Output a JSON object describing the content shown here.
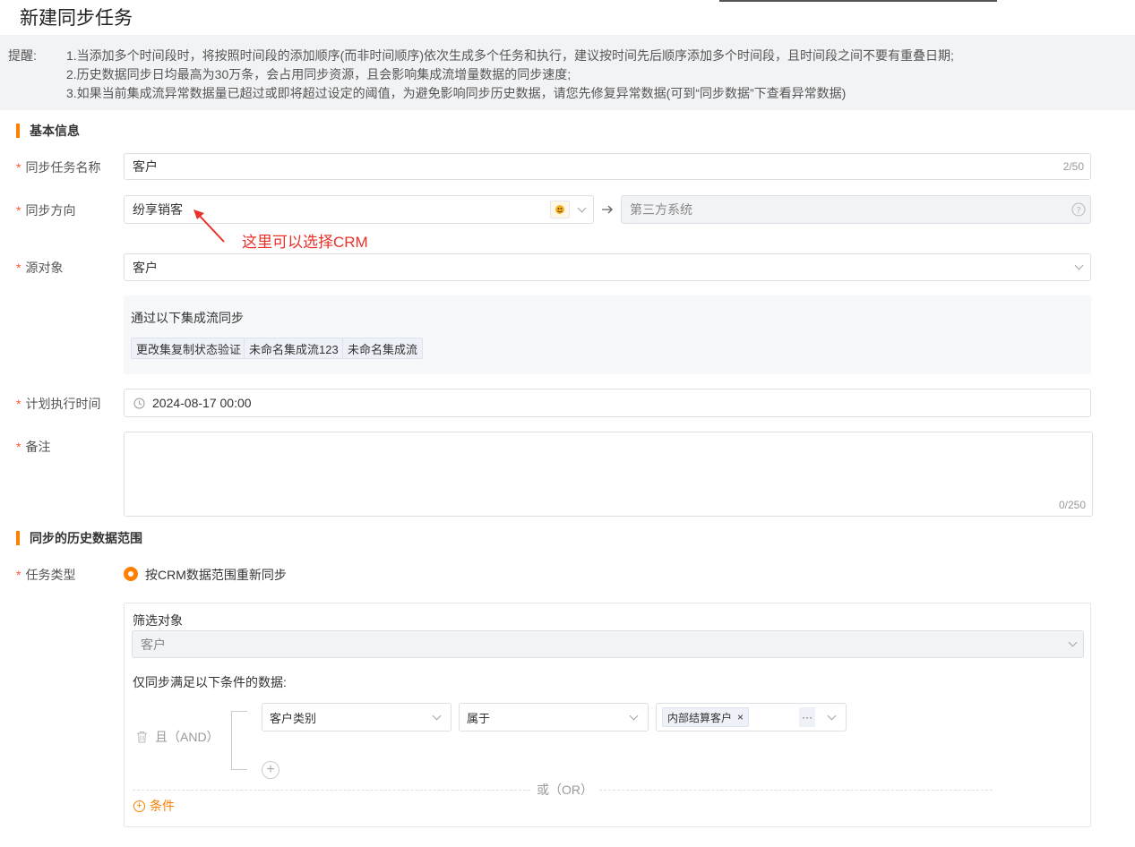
{
  "header": {
    "title": "新建同步任务"
  },
  "notice": {
    "label": "提醒:",
    "lines": [
      "1.当添加多个时间段时，将按照时间段的添加顺序(而非时间顺序)依次生成多个任务和执行，建议按时间先后顺序添加多个时间段，且时间段之间不要有重叠日期;",
      "2.历史数据同步日均最高为30万条，会占用同步资源，且会影响集成流增量数据的同步速度;",
      "3.如果当前集成流异常数据量已超过或即将超过设定的阈值，为避免影响同步历史数据，请您先修复异常数据(可到“同步数据”下查看异常数据)"
    ]
  },
  "basic": {
    "section_title": "基本信息",
    "required_mark": "*",
    "task_name_label": "同步任务名称",
    "task_name_value": "客户",
    "task_name_count": "2/50",
    "direction_label": "同步方向",
    "direction_source": "纷享销客",
    "direction_target": "第三方系统",
    "annotation": "这里可以选择CRM",
    "source_object_label": "源对象",
    "source_object_value": "客户",
    "flow_title": "通过以下集成流同步",
    "flows": [
      "更改集复制状态验证",
      "未命名集成流123",
      "未命名集成流"
    ],
    "schedule_label": "计划执行时间",
    "schedule_value": "2024-08-17 00:00",
    "remark_label": "备注",
    "remark_value": "",
    "remark_count": "0/250"
  },
  "history": {
    "section_title": "同步的历史数据范围",
    "task_type_label": "任务类型",
    "task_type_option": "按CRM数据范围重新同步",
    "filter_object_label": "筛选对象",
    "filter_object_value": "客户",
    "condition_title": "仅同步满足以下条件的数据:",
    "and_label": "且（AND）",
    "field_value": "客户类别",
    "operator_value": "属于",
    "value_tag": "内部结算客户",
    "value_tag_remove": "×",
    "more_label": "···",
    "or_label": "或（OR）",
    "add_condition_label": "条件",
    "add_symbol": "+"
  },
  "colors": {
    "accent": "#ff8000",
    "required": "#ff5730",
    "annotation": "#e8322a"
  }
}
